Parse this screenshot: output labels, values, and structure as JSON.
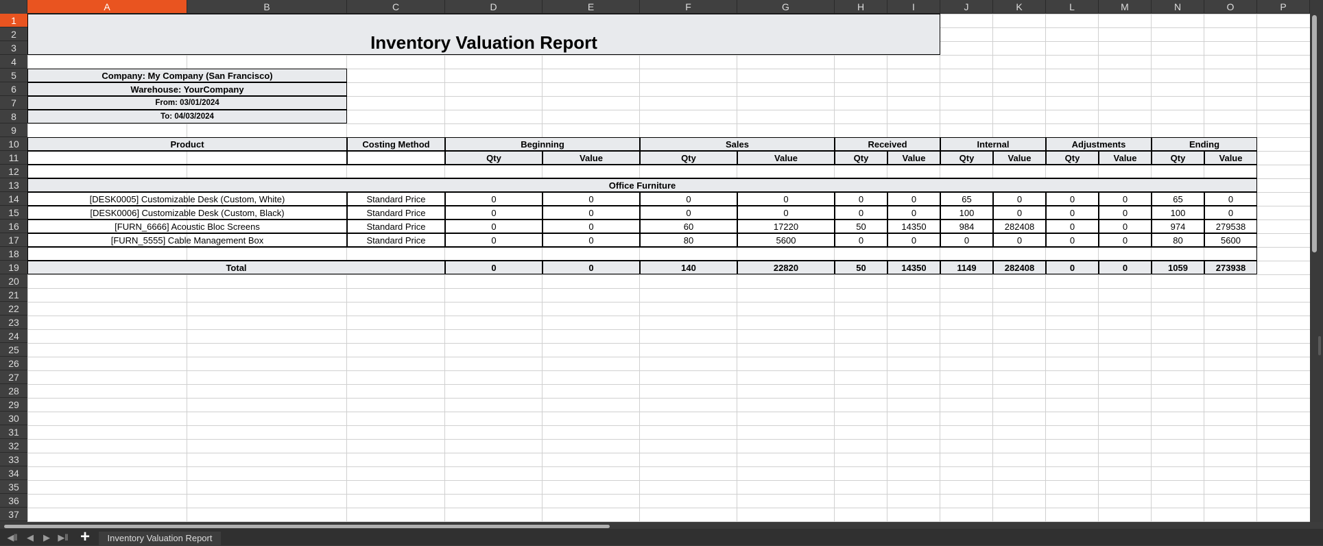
{
  "columns": [
    "A",
    "B",
    "C",
    "D",
    "E",
    "F",
    "G",
    "H",
    "I",
    "J",
    "K",
    "L",
    "M",
    "N",
    "O",
    "P"
  ],
  "selected_column": "A",
  "rows": [
    "1",
    "2",
    "3",
    "4",
    "5",
    "6",
    "7",
    "8",
    "9",
    "10",
    "11",
    "12",
    "13",
    "14",
    "15",
    "16",
    "17",
    "18",
    "19",
    "20",
    "21",
    "22",
    "23",
    "24",
    "25",
    "26",
    "27",
    "28",
    "29",
    "30",
    "31",
    "32",
    "33",
    "34",
    "35",
    "36",
    "37"
  ],
  "selected_row": "1",
  "report": {
    "title": "Inventory Valuation Report",
    "company": "Company: My Company (San Francisco)",
    "warehouse": "Warehouse: YourCompany",
    "from": "From: 03/01/2024",
    "to": "To: 04/03/2024"
  },
  "table": {
    "product_header": "Product",
    "costing_header": "Costing Method",
    "groups": [
      "Beginning",
      "Sales",
      "Received",
      "Internal",
      "Adjustments",
      "Ending"
    ],
    "sub_qty": "Qty",
    "sub_value": "Value",
    "category": "Office Furniture",
    "rows": [
      {
        "product": "[DESK0005] Customizable Desk (Custom, White)",
        "method": "Standard Price",
        "values": [
          "0",
          "0",
          "0",
          "0",
          "0",
          "0",
          "65",
          "0",
          "0",
          "0",
          "65",
          "0"
        ]
      },
      {
        "product": "[DESK0006] Customizable Desk (Custom, Black)",
        "method": "Standard Price",
        "values": [
          "0",
          "0",
          "0",
          "0",
          "0",
          "0",
          "100",
          "0",
          "0",
          "0",
          "100",
          "0"
        ]
      },
      {
        "product": "[FURN_6666] Acoustic Bloc Screens",
        "method": "Standard Price",
        "values": [
          "0",
          "0",
          "60",
          "17220",
          "50",
          "14350",
          "984",
          "282408",
          "0",
          "0",
          "974",
          "279538"
        ]
      },
      {
        "product": "[FURN_5555] Cable Management Box",
        "method": "Standard Price",
        "values": [
          "0",
          "0",
          "80",
          "5600",
          "0",
          "0",
          "0",
          "0",
          "0",
          "0",
          "80",
          "5600"
        ]
      }
    ],
    "total_label": "Total",
    "totals": [
      "0",
      "0",
      "140",
      "22820",
      "50",
      "14350",
      "1149",
      "282408",
      "0",
      "0",
      "1059",
      "273938"
    ]
  },
  "sheet_tab": "Inventory Valuation Report",
  "icons": {
    "first": "first-sheet-icon",
    "prev": "prev-sheet-icon",
    "next": "next-sheet-icon",
    "last": "last-sheet-icon",
    "add": "add-sheet-icon"
  }
}
